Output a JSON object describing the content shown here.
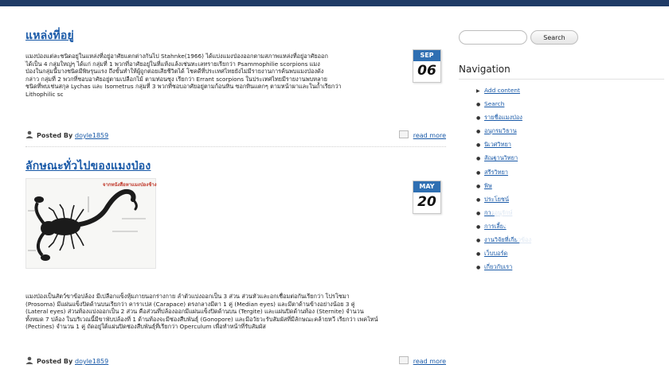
{
  "posts": [
    {
      "title": "แหล่งที่อยู่",
      "month": "SEP",
      "day": "06",
      "body_lines": [
        "แมงป่องแต่ละชนิดอยู่ในแหล่งที่อยู่อาศัยแตกต่างกันไป Stahnke(1966) ได้แบ่งแมงป่องออกตามสภาพแหล่งที่อยู่อาศัยออก",
        "ได้เป็น 4 กลุ่มใหญ่ๆ ได้แก่ กลุ่มที่ 1 พวกที่อาศัยอยู่ในที่แห้งแล้งเช่นทะเลทรายเรียกว่า Psammophilie scorpions แมง",
        "ป่องในกลุ่มนี้บางชนิดมีพิษรุนแรง ถึงขั้นทำให้ผู้ถูกต่อยเสียชีวิตได้ โชคดีที่ประเทศไทยยังไม่มีรายงานการค้นพบแมงป่องดัง",
        "กล่าว กลุ่มที่ 2 พวกที่ชอบอาศัยอยู่ตามเปลือกไม้ ตามท่อนซุง เรียกว่า Errant scorpions ในประเทศไทยมีรายงานพบหลาย",
        "ชนิดที่พบเช่นสกุล Lychas และ Isometrus กลุ่มที่ 3 พวกที่ชอบอาศัยอยู่ตามก้อนหิน ซอกหินแตกๆ ตามหน้าผาและในถ้ำเรียกว่า",
        "Lithophilic sc"
      ],
      "posted_by_label": "Posted By",
      "author": "doyle1859",
      "read_more": "read more"
    },
    {
      "title": "ลักษณะทั่วไปของแมงป่อง",
      "month": "MAY",
      "day": "20",
      "image_caption": "จากหนังสือหาแมงป่องช้าง",
      "body_lines": [
        "แมงป่องเป็นสัตว์ขาข้อปล้อง มีเปลือกแข็งหุ้มภายนอกร่างกาย ลำตัวแบ่งออกเป็น 3 ส่วน ส่วนหัวและอกเชื่อมต่อกันเรียกว่า โปรโซมา",
        "(Prosoma) มีแผ่นแข็งปิดด้านบนเรียกว่า คาราเปส (Carapace) ตรงกลางมีตา 1 คู่ (Median eyes) และมีตาด้านข้างอย่างน้อย 3 คู่",
        "(Lateral eyes) ส่วนท้องแบ่งออกเป็น 2 ส่วน คือส่วนที่ปล้องออกมีแผ่นแข็งปิดด้านบน (Tergite) และแผ่นปิดด้านท้อง (Sternite) จำนวน",
        "ทั้งหมด 7 ปล้อง ในบริเวณนี้มีขาพับปล้องที่ 1 ด้านท้องจะมีช่องสืบพันธุ์ (Gonopore) และมีอวัยวะรับสัมผัสที่มีลักษณะคล้ายหวี เรียกว่า เพคไทน์",
        "(Pectines) จำนวน 1 คู่ ถัดอยู่ใต้แผ่นปิดช่องสืบพันธุ์ที่เรียกว่า Operculum เพื่อทำหน้าที่รับสัมผัส"
      ],
      "posted_by_label": "Posted By",
      "author": "doyle1859",
      "read_more": "read more"
    }
  ],
  "sidebar": {
    "search_placeholder": "",
    "search_button": "Search",
    "nav_title": "Navigation",
    "nav_items": [
      {
        "label": "Add content",
        "bullet": "▶"
      },
      {
        "label": "Search",
        "bullet": "●"
      },
      {
        "label": "รายชื่อแมงป่อง",
        "bullet": "●"
      },
      {
        "label": "อนุกรมวิธาน",
        "bullet": "●"
      },
      {
        "label": "นิเวศวิทยา",
        "bullet": "●"
      },
      {
        "label": "สัณฐานวิทยา",
        "bullet": "●"
      },
      {
        "label": "สรีรวิทยา",
        "bullet": "●"
      },
      {
        "label": "พิษ",
        "bullet": "●"
      },
      {
        "label": "ประโยชน์",
        "bullet": "●"
      },
      {
        "label": "การอนุรักษ์",
        "bullet": "●"
      },
      {
        "label": "การเลี้ยง",
        "bullet": "●"
      },
      {
        "label": "งานวิจัยที่เกี่ยวข้อง",
        "bullet": "●"
      },
      {
        "label": "เว็บบอร์ด",
        "bullet": "●"
      },
      {
        "label": "เกี่ยวกับเรา",
        "bullet": "●"
      }
    ]
  },
  "colors": {
    "topbar": "#1f3b66",
    "link": "#1a5aa8",
    "date_badge": "#2f6fb2"
  }
}
